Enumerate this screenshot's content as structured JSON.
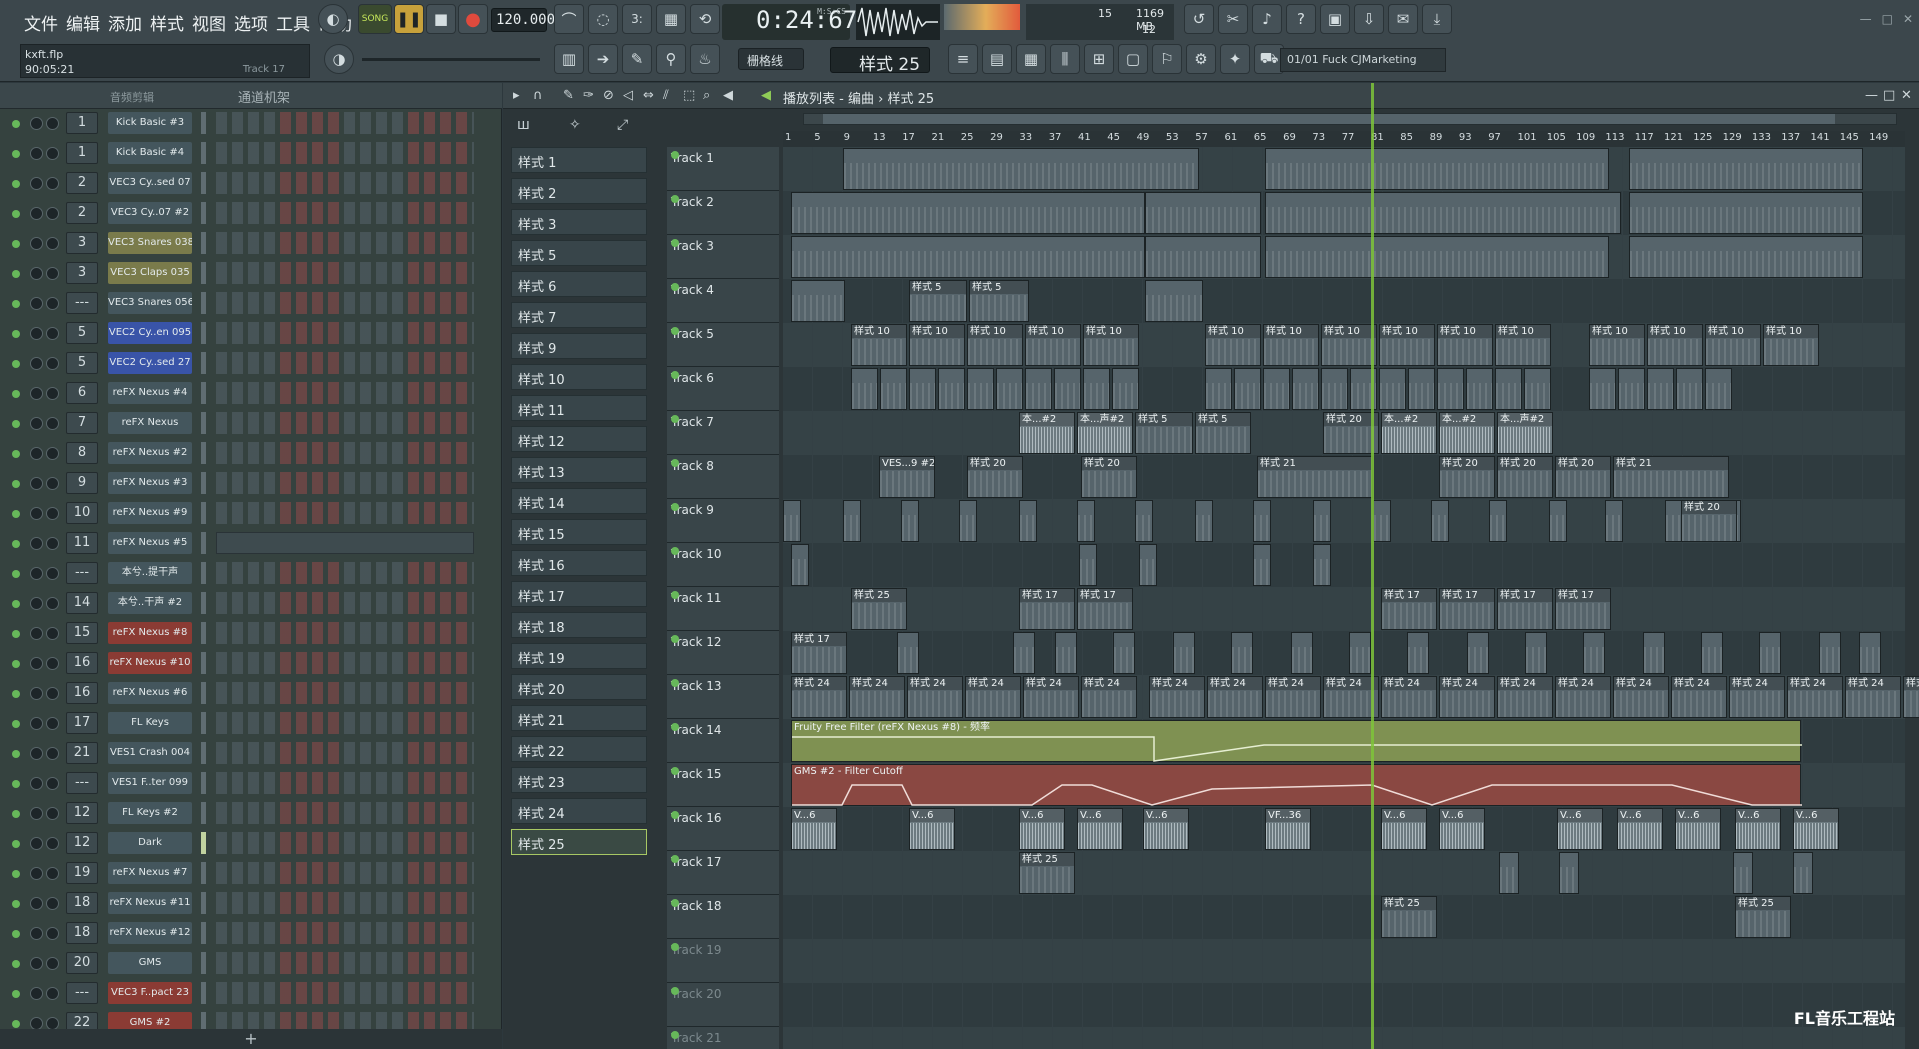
{
  "menu": [
    "文件",
    "编辑",
    "添加",
    "样式",
    "视图",
    "选项",
    "工具",
    "帮助"
  ],
  "hint": {
    "file": "kxft.flp",
    "time": "90:05:21",
    "track": "Track 17"
  },
  "transport": {
    "mode": "SONG",
    "tempo": "120.000",
    "clock": "0:24:67",
    "clock_label": "M:S:CS"
  },
  "cpu": {
    "a": "15",
    "mem": "1169 MB",
    "poly": "12"
  },
  "snap": "栅格线",
  "pattern_selected": "样式 25",
  "news": "01/01  Fuck CJMarketing",
  "rack": {
    "header_filter": "音频剪辑",
    "header_title": "通道机架",
    "footer": "+"
  },
  "channels": [
    {
      "num": "1",
      "name": "Kick Basic #3",
      "style": ""
    },
    {
      "num": "1",
      "name": "Kick Basic #4",
      "style": ""
    },
    {
      "num": "2",
      "name": "VEC3 Cy..sed 07",
      "style": ""
    },
    {
      "num": "2",
      "name": "VEC3 Cy..07 #2",
      "style": ""
    },
    {
      "num": "3",
      "name": "VEC3 Snares 038",
      "style": "vyel"
    },
    {
      "num": "3",
      "name": "VEC3 Claps 035",
      "style": "vyel"
    },
    {
      "num": "---",
      "name": "VEC3 Snares 056",
      "style": ""
    },
    {
      "num": "5",
      "name": "VEC2 Cy..en 095",
      "style": "vblue"
    },
    {
      "num": "5",
      "name": "VEC2 Cy..sed 27",
      "style": "vblue"
    },
    {
      "num": "6",
      "name": "reFX Nexus #4",
      "style": ""
    },
    {
      "num": "7",
      "name": "reFX Nexus",
      "style": ""
    },
    {
      "num": "8",
      "name": "reFX Nexus #2",
      "style": ""
    },
    {
      "num": "9",
      "name": "reFX Nexus #3",
      "style": ""
    },
    {
      "num": "10",
      "name": "reFX Nexus #9",
      "style": ""
    },
    {
      "num": "11",
      "name": "reFX Nexus #5",
      "style": ""
    },
    {
      "num": "---",
      "name": "本兮..提干声",
      "style": ""
    },
    {
      "num": "14",
      "name": "本兮..干声 #2",
      "style": ""
    },
    {
      "num": "15",
      "name": "reFX Nexus #8",
      "style": "vred"
    },
    {
      "num": "16",
      "name": "reFX Nexus #10",
      "style": "vred"
    },
    {
      "num": "16",
      "name": "reFX Nexus #6",
      "style": ""
    },
    {
      "num": "17",
      "name": "FL Keys",
      "style": ""
    },
    {
      "num": "21",
      "name": "VES1 Crash 004",
      "style": ""
    },
    {
      "num": "---",
      "name": "VES1 F..ter 099",
      "style": ""
    },
    {
      "num": "12",
      "name": "FL Keys #2",
      "style": ""
    },
    {
      "num": "12",
      "name": "Dark",
      "style": ""
    },
    {
      "num": "19",
      "name": "reFX Nexus #7",
      "style": ""
    },
    {
      "num": "18",
      "name": "reFX Nexus #11",
      "style": ""
    },
    {
      "num": "18",
      "name": "reFX Nexus #12",
      "style": ""
    },
    {
      "num": "20",
      "name": "GMS",
      "style": ""
    },
    {
      "num": "---",
      "name": "VEC3 F..pact 23",
      "style": "vred"
    },
    {
      "num": "22",
      "name": "GMS #2",
      "style": "vred"
    }
  ],
  "playlist": {
    "title": "播放列表 - 编曲",
    "crumb_pattern": "样式 25"
  },
  "patterns": [
    "样式 1",
    "样式 2",
    "样式 3",
    "样式 5",
    "样式 6",
    "样式 7",
    "样式 9",
    "样式 10",
    "样式 11",
    "样式 12",
    "样式 13",
    "样式 14",
    "样式 15",
    "样式 16",
    "样式 17",
    "样式 18",
    "样式 19",
    "样式 20",
    "样式 21",
    "样式 22",
    "样式 23",
    "样式 24",
    "样式 25"
  ],
  "tracks": [
    "Track 1",
    "Track 2",
    "Track 3",
    "Track 4",
    "Track 5",
    "Track 6",
    "Track 7",
    "Track 8",
    "Track 9",
    "Track 10",
    "Track 11",
    "Track 12",
    "Track 13",
    "Track 14",
    "Track 15",
    "Track 16",
    "Track 17",
    "Track 18",
    "Track 19",
    "Track 20",
    "Track 21"
  ],
  "ruler": [
    "1",
    "5",
    "9",
    "13",
    "17",
    "21",
    "25",
    "29",
    "33",
    "37",
    "41",
    "45",
    "49",
    "53",
    "57",
    "61",
    "65",
    "69",
    "73",
    "77",
    "81",
    "85",
    "89",
    "93",
    "97",
    "101",
    "105",
    "109",
    "113",
    "117",
    "121",
    "125",
    "129",
    "133",
    "137",
    "141",
    "145",
    "149"
  ],
  "clip_labels": {
    "t4": [
      "样式 5",
      "样式 5"
    ],
    "t5": "样式 10",
    "t7": [
      "本...#2",
      "本...声#2",
      "样式 5",
      "样式 5",
      "样式 20",
      "本...#2",
      "本...#2",
      "本...声#2"
    ],
    "t8": [
      "VES...9 #2",
      "样式 20",
      "样式 20",
      "样式 21",
      "样式 20",
      "样式 20",
      "样式 20",
      "样式 21"
    ],
    "t9": "样式 20",
    "t11": [
      "样式 25",
      "样式 17",
      "样式 17",
      "样式 17",
      "样式 17",
      "样式 17",
      "样式 17"
    ],
    "t12": "样式 17",
    "t13": "样式 24",
    "t14": "Fruity Free Filter (reFX Nexus #8) - 频率",
    "t15": "GMS #2 - Filter Cutoff",
    "t16": [
      "V...6",
      "V...6",
      "V...6",
      "V...6",
      "V...6",
      "VF...36",
      "V...6",
      "V...6",
      "V...6",
      "V...6",
      "V...6",
      "V...6",
      "V...6"
    ],
    "t17": "样式 25",
    "t18": [
      "样式 25",
      "样式 25"
    ]
  },
  "watermark": "FL音乐工程站"
}
